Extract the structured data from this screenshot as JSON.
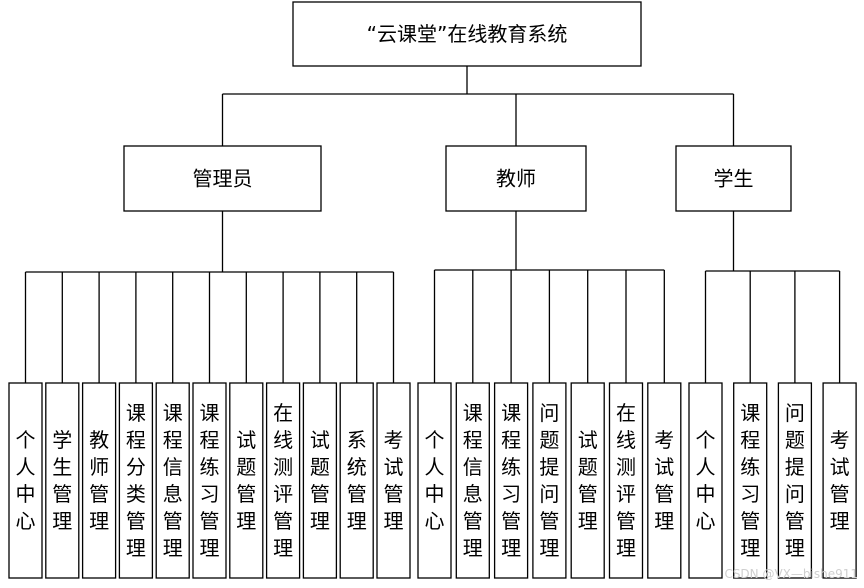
{
  "root": {
    "label": "“云课堂”在线教育系统"
  },
  "roles": [
    {
      "label": "管理员",
      "functions": [
        "个人中心",
        "学生管理",
        "教师管理",
        "课程分类管理",
        "课程信息管理",
        "课程练习管理",
        "试题管理",
        "在线测评管理",
        "试题管理",
        "系统管理",
        "考试管理"
      ]
    },
    {
      "label": "教师",
      "functions": [
        "个人中心",
        "课程信息管理",
        "课程练习管理",
        "问题提问管理",
        "试题管理",
        "在线测评管理",
        "考试管理"
      ]
    },
    {
      "label": "学生",
      "functions": [
        "个人中心",
        "课程练习管理",
        "问题提问管理",
        "考试管理"
      ]
    }
  ],
  "watermark": "CSDN @VX—bishe911"
}
